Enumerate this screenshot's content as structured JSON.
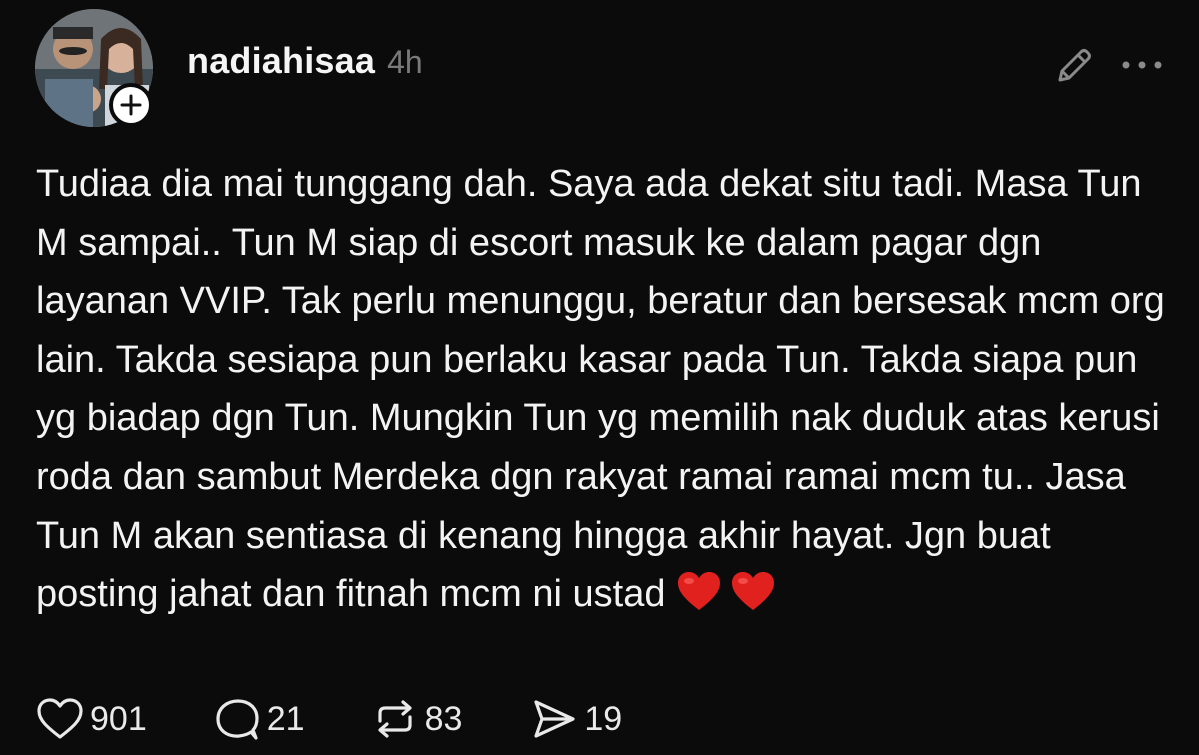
{
  "post": {
    "username": "nadiahisaa",
    "timestamp": "4h",
    "text": "Tudiaa dia mai tunggang dah. Saya ada dekat situ tadi. Masa Tun M sampai.. Tun M siap di escort masuk ke dalam pagar dgn layanan VVIP. Tak perlu menunggu, beratur dan bersesak mcm org lain. Takda sesiapa pun berlaku kasar pada Tun. Takda siapa pun yg biadap dgn Tun. Mungkin Tun yg memilih nak duduk atas kerusi roda dan sambut Merdeka dgn rakyat ramai ramai mcm tu.. Jasa Tun M akan sentiasa di kenang hingga akhir hayat. Jgn buat posting jahat dan fitnah mcm ni ustad",
    "emoji": [
      "heart",
      "heart"
    ]
  },
  "actions": {
    "likes": "901",
    "comments": "21",
    "reposts": "83",
    "shares": "19"
  },
  "icons": {
    "follow": "plus-icon",
    "edit": "pencil-icon",
    "more": "more-dots-icon",
    "like": "heart-outline-icon",
    "comment": "speech-bubble-icon",
    "repost": "repost-arrows-icon",
    "share": "send-paper-plane-icon"
  },
  "colors": {
    "background": "#0b0b0b",
    "text": "#f3f3f3",
    "muted": "#7a7a7a",
    "heart": "#e0211e"
  }
}
